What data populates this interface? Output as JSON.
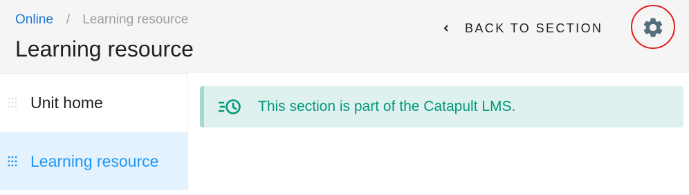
{
  "breadcrumb": {
    "parent": "Online",
    "separator": "/",
    "current": "Learning resource"
  },
  "page_title": "Learning resource",
  "header": {
    "back_label": "BACK TO SECTION",
    "settings_icon": "gear-icon"
  },
  "sidebar": {
    "items": [
      {
        "label": "Unit home",
        "active": false
      },
      {
        "label": "Learning resource",
        "active": true
      }
    ]
  },
  "notice": {
    "text": "This section is part of the Catapult LMS.",
    "icon": "history-clock-icon"
  },
  "colors": {
    "link": "#1976d2",
    "active_item_text": "#2196f3",
    "active_item_bg": "#e3f2fd",
    "notice_text": "#009879",
    "notice_bg": "#dff1ee",
    "highlight_ring": "#e31c1c",
    "gear": "#546e7a"
  }
}
